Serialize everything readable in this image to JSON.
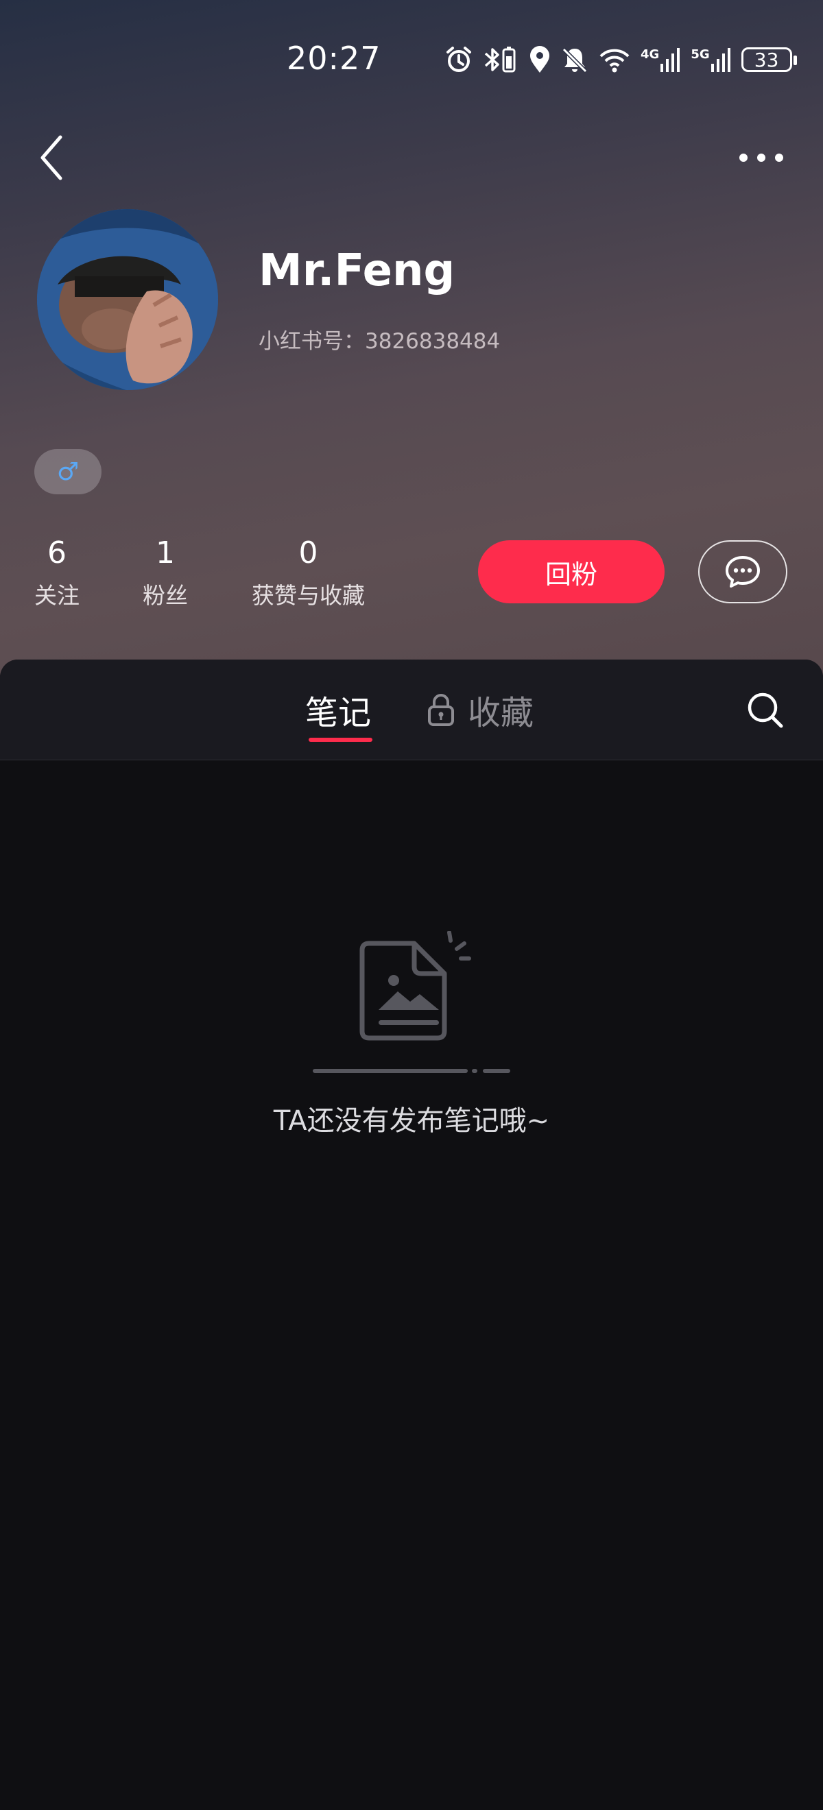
{
  "status_bar": {
    "time": "20:27",
    "network_4g": "4G",
    "network_5g": "5G",
    "battery": "33"
  },
  "navigation": {
    "back_icon": "chevron-left-icon",
    "more_icon": "more-horizontal-icon"
  },
  "profile": {
    "username": "Mr.Feng",
    "user_id": "小红书号：3826838484",
    "gender_symbol": "♂",
    "gender_color": "#5aa8f5"
  },
  "stats": [
    {
      "value": "6",
      "label": "关注"
    },
    {
      "value": "1",
      "label": "粉丝"
    },
    {
      "value": "0",
      "label": "获赞与收藏"
    }
  ],
  "actions": {
    "follow_back_label": "回粉",
    "message_icon": "chat-bubble-icon",
    "accent_color": "#fe2c4c"
  },
  "tabs": {
    "notes_label": "笔记",
    "favorites_label": "收藏",
    "favorites_icon": "lock-icon",
    "search_icon": "search-icon"
  },
  "empty_state": {
    "message": "TA还没有发布笔记哦~",
    "illustration_icon": "empty-note-icon"
  }
}
